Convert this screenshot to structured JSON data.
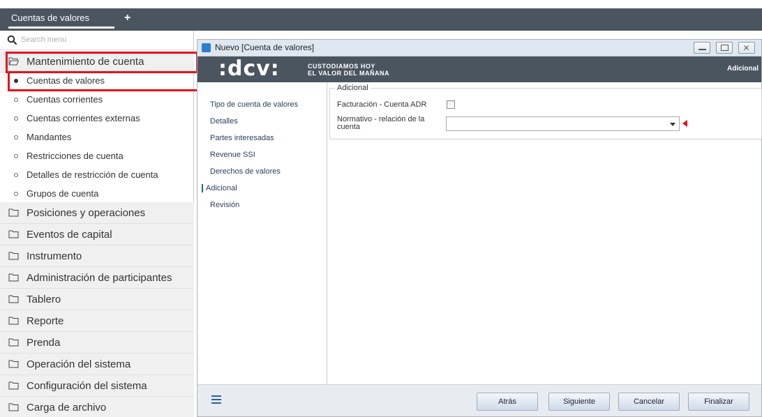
{
  "tabs": {
    "active_label": "Cuentas de valores",
    "add_label": "+"
  },
  "sidebar": {
    "search_placeholder": "Search menu",
    "open_group": "Mantenimiento de cuenta",
    "subitems": [
      "Cuentas de valores",
      "Cuentas corrientes",
      "Cuentas corrientes externas",
      "Mandantes",
      "Restricciones de cuenta",
      "Detalles de restricción de cuenta",
      "Grupos de cuenta"
    ],
    "groups": [
      "Posiciones y operaciones",
      "Eventos de capital",
      "Instrumento",
      "Administración de participantes",
      "Tablero",
      "Reporte",
      "Prenda",
      "Operación del sistema",
      "Configuración del sistema",
      "Carga de archivo"
    ]
  },
  "dialog": {
    "title": "Nuevo [Cuenta de valores]",
    "logo_text": ":dcv:",
    "tagline_line1": "CUSTODIAMOS HOY",
    "tagline_line2": "EL VALOR DEL MAÑANA",
    "header_right": "Adicional",
    "nav": [
      "Tipo de cuenta de valores",
      "Detalles",
      "Partes interesadas",
      "Revenue SSI",
      "Derechos de valores",
      "Adicional",
      "Revisión"
    ],
    "active_nav_index": 5,
    "section_legend": "Adicional",
    "fields": {
      "adr_label": "Facturación - Cuenta ADR",
      "adr_checked": false,
      "normativo_label_line1": "Normativo - relación de la",
      "normativo_label_line2": "cuenta",
      "normativo_value": ""
    },
    "buttons": {
      "back": "Atrás",
      "next": "Siguiente",
      "cancel": "Cancelar",
      "finish": "Finalizar"
    }
  },
  "colors": {
    "header_bg": "#4b5560",
    "highlight": "#e8101a",
    "nav_text": "#2a3f60"
  }
}
